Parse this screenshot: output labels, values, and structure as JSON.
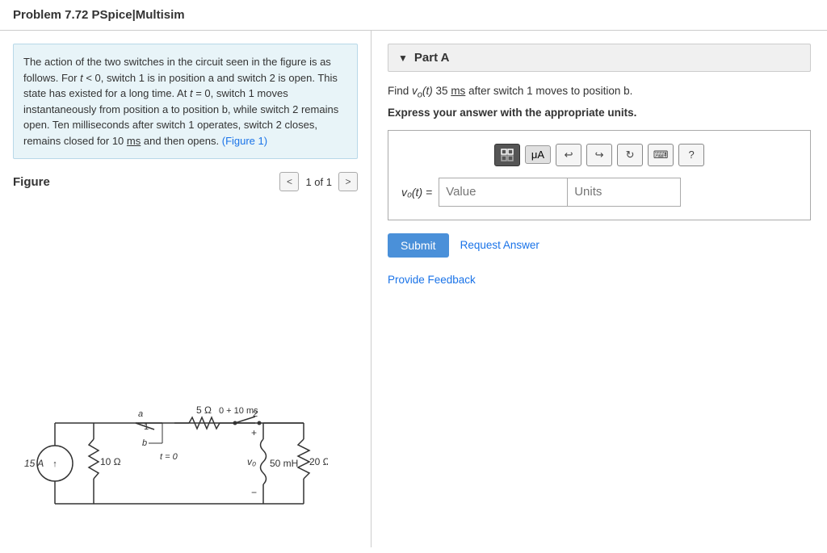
{
  "header": {
    "title": "Problem 7.72 PSpice|Multisim"
  },
  "left": {
    "problem_text": "The action of the two switches in the circuit seen in the figure is as follows. For t < 0, switch 1 is in position a and switch 2 is open. This state has existed for a long time. At t = 0, switch 1 moves instantaneously from position a to position b, while switch 2 remains open. Ten milliseconds after switch 1 operates, switch 2 closes, remains closed for 10 ms and then opens.",
    "figure_link_text": "(Figure 1)",
    "figure_label": "Figure",
    "nav_prev": "<",
    "nav_next": ">",
    "page_text": "1 of 1"
  },
  "right": {
    "part_label": "Part A",
    "question_text_prefix": "Find ",
    "question_var": "v₀(t)",
    "question_time": "35 ms",
    "question_suffix": " after switch 1 moves to position b.",
    "instruction": "Express your answer with the appropriate units.",
    "toolbar": {
      "matrix_icon": "⊞",
      "unit_label": "μA",
      "undo_icon": "↩",
      "redo_icon": "↪",
      "refresh_icon": "↻",
      "keyboard_icon": "⌨",
      "help_icon": "?"
    },
    "input": {
      "equation_label": "v₀(t) =",
      "value_placeholder": "Value",
      "units_placeholder": "Units"
    },
    "submit_label": "Submit",
    "request_label": "Request Answer",
    "feedback_label": "Provide Feedback"
  },
  "colors": {
    "accent": "#4a90d9",
    "link": "#1a73e8",
    "panel_bg": "#e8f4f8",
    "toolbar_active": "#555555"
  }
}
